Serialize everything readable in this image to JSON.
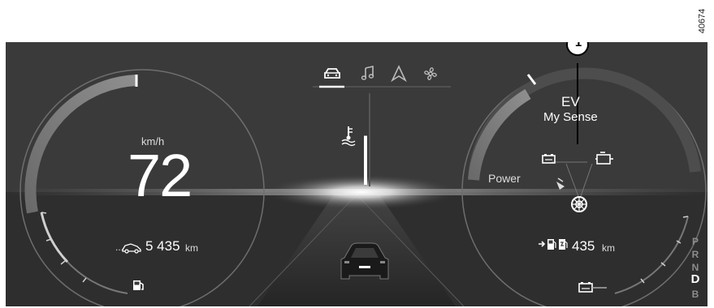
{
  "reference_code": "40674",
  "callout": {
    "number": "1"
  },
  "top_menu": {
    "items": [
      {
        "icon": "car-icon",
        "active": true
      },
      {
        "icon": "music-note-icon",
        "active": false
      },
      {
        "icon": "navigation-arrow-icon",
        "active": false
      },
      {
        "icon": "fan-icon",
        "active": false
      }
    ]
  },
  "speedometer": {
    "unit": "km/h",
    "speed": "72",
    "odometer_value": "5 435",
    "odometer_unit": "km",
    "fuel_level": 0.45
  },
  "center": {
    "temperature_icon": "coolant-temperature-icon",
    "temperature_level": 0.55
  },
  "power_gauge": {
    "mode": "EV",
    "drive_mode": "My Sense",
    "label": "Power",
    "range_value": "435",
    "range_unit": "km",
    "energy_flow_icons": [
      "battery-icon",
      "engine-icon",
      "wheel-icon"
    ],
    "battery_level": 0.35
  },
  "gear_selector": {
    "gears": [
      "P",
      "R",
      "N",
      "D",
      "B"
    ],
    "selected": "D"
  }
}
